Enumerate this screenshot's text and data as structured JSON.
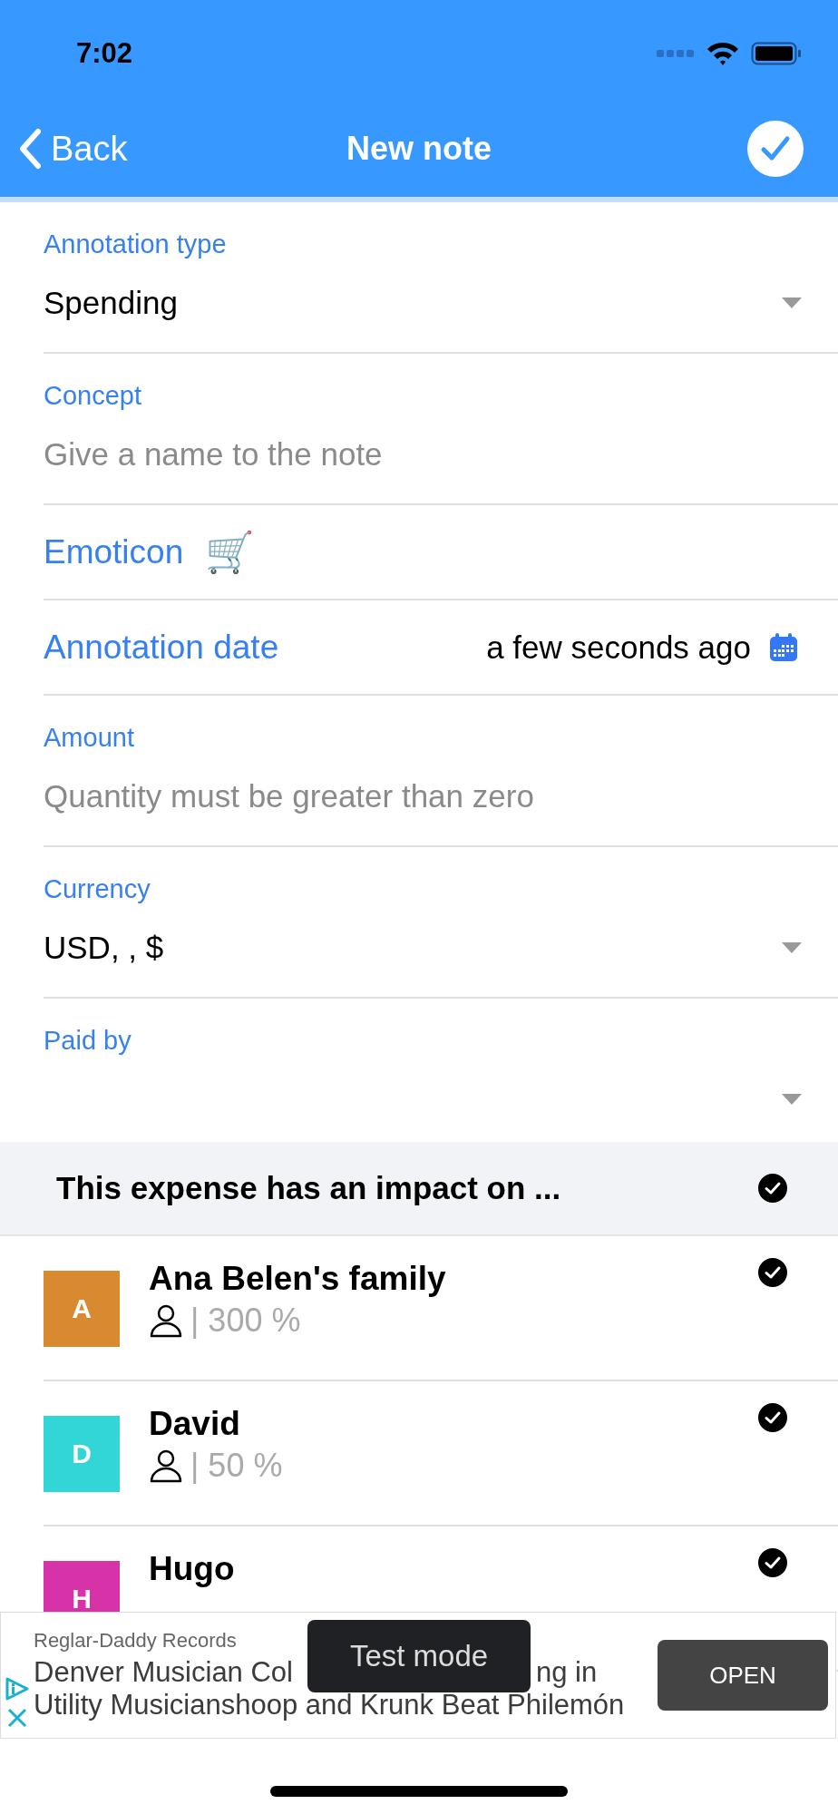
{
  "status_bar": {
    "time": "7:02"
  },
  "nav": {
    "back": "Back",
    "title": "New note"
  },
  "fields": [
    {
      "kind": "select",
      "label": "Annotation type",
      "value": "Spending"
    },
    {
      "kind": "input",
      "label": "Concept",
      "placeholder": "Give a name to the note"
    },
    {
      "kind": "emoticon",
      "label": "Emoticon",
      "value": "🛒"
    },
    {
      "kind": "date",
      "label": "Annotation date",
      "value": "a few seconds ago"
    },
    {
      "kind": "input",
      "label": "Amount",
      "placeholder": "Quantity must be greater than zero"
    },
    {
      "kind": "select",
      "label": "Currency",
      "value": "USD, , $"
    },
    {
      "kind": "select",
      "label": "Paid by"
    }
  ],
  "impact": {
    "title": "This expense has an impact on ...",
    "checked": true,
    "members": [
      {
        "initial": "A",
        "name": "Ana Belen's family",
        "share": "| 300 %",
        "color": "#d98a30",
        "checked": true
      },
      {
        "initial": "D",
        "name": "David",
        "share": "| 50 %",
        "color": "#33d6d6",
        "checked": true
      },
      {
        "initial": "H",
        "name": "Hugo",
        "color": "#d832a8",
        "checked": true
      }
    ]
  },
  "ad": {
    "advertiser": "Reglar-Daddy Records",
    "headline_start": "Denver Musician Col",
    "headline_end": "ng in",
    "headline_line2": "Utility Musicianshoop and Krunk Beat Philemón",
    "button": "OPEN",
    "toast": "Test mode"
  }
}
